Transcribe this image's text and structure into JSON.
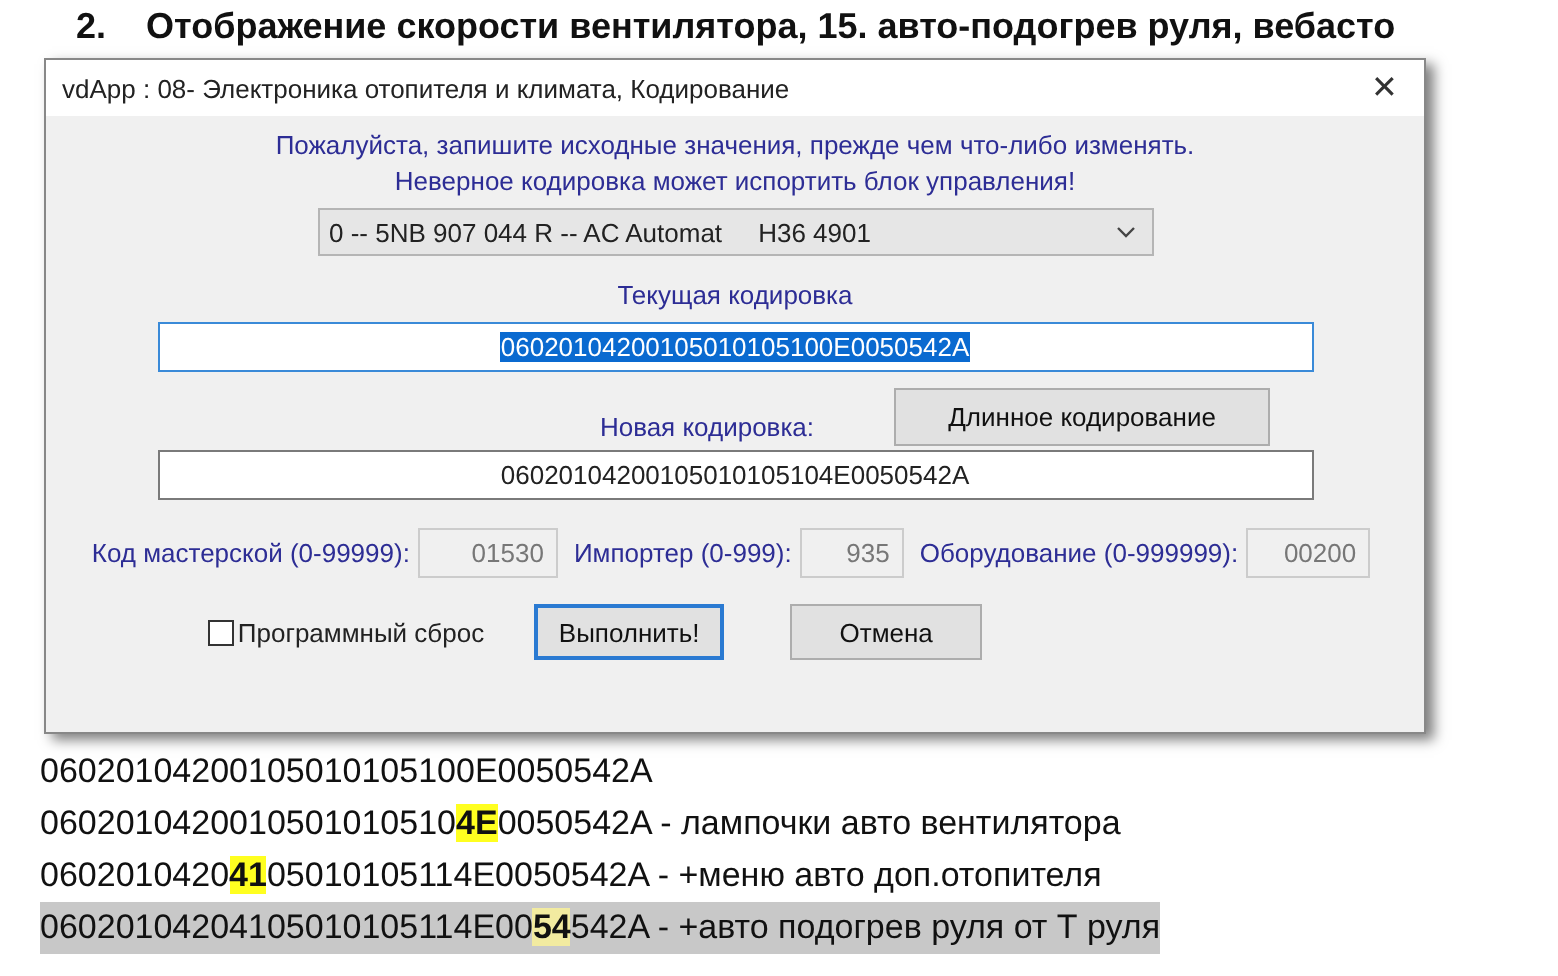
{
  "heading": {
    "number": "2.",
    "text": "Отображение скорости вентилятора, 15. авто-подогрев руля, вебасто"
  },
  "dialog": {
    "title": "vdApp : 08- Электроника отопителя и климата,  Кодирование",
    "close": "✕",
    "warning": [
      "Пожалуйста, запишите исходные значения, прежде чем что-либо изменять.",
      "Неверное кодировка может испортить блок управления!"
    ],
    "module_select": "0 -- 5NB 907 044 R -- AC Automat     H36 4901",
    "current_label": "Текущая кодировка",
    "current_value": "06020104200105010105100E0050542A",
    "new_label": "Новая кодировка:",
    "long_coding_button": "Длинное кодирование",
    "new_value": "06020104200105010105104E0050542A",
    "fields": [
      {
        "label": "Код мастерской (0-99999):",
        "value": "01530"
      },
      {
        "label": "Импортер (0-999):",
        "value": "935"
      },
      {
        "label": "Оборудование (0-999999):",
        "value": "00200"
      }
    ],
    "reset_checkbox": {
      "label": "Программный сброс",
      "checked": false
    },
    "buttons": [
      {
        "label": "Выполнить!",
        "focused": true
      },
      {
        "label": "Отмена",
        "focused": false
      }
    ]
  },
  "code_lines": [
    {
      "selected": false,
      "parts": [
        {
          "text": "06020104200105010105100E0050542A",
          "highlighted": false
        }
      ]
    },
    {
      "selected": false,
      "parts": [
        {
          "text": "0602010420010501010510",
          "highlighted": false
        },
        {
          "text": "4E",
          "highlighted": true
        },
        {
          "text": "0050542A - лампочки авто вентилятора",
          "highlighted": false
        }
      ]
    },
    {
      "selected": false,
      "parts": [
        {
          "text": "0602010420",
          "highlighted": false
        },
        {
          "text": "41",
          "highlighted": true
        },
        {
          "text": "05010105114E0050542A - +меню авто доп.отопителя",
          "highlighted": false
        }
      ]
    },
    {
      "selected": true,
      "parts": [
        {
          "text": "06020104204105010105114E00",
          "highlighted": false
        },
        {
          "text": "54",
          "highlighted": true
        },
        {
          "text": "542A - +авто подогрев руля от Т руля",
          "highlighted": false
        }
      ]
    }
  ]
}
